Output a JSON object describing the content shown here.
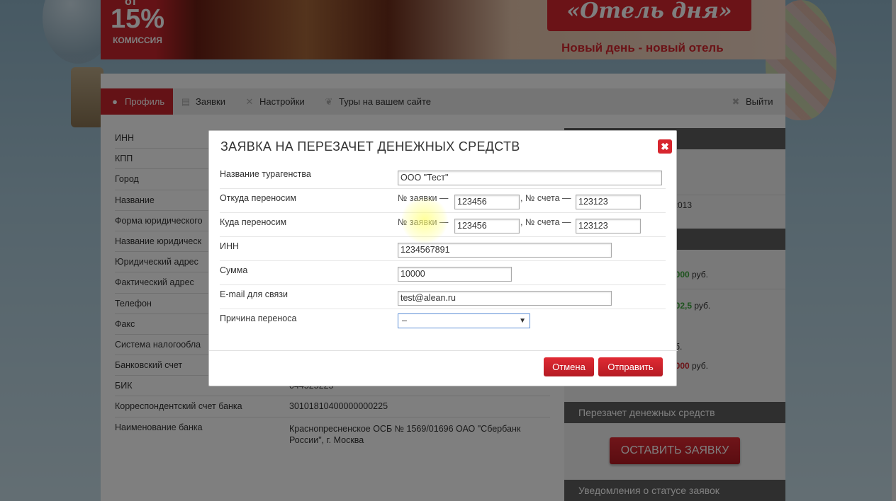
{
  "banner": {
    "promo_top": "от",
    "promo_percent": "15%",
    "promo_sub": "КОМИССИЯ",
    "hotel_day": "«Отель дня»",
    "slogan": "Новый день - новый отель"
  },
  "nav": {
    "items": [
      {
        "label": "Профиль",
        "icon": "user-icon"
      },
      {
        "label": "Заявки",
        "icon": "list-icon"
      },
      {
        "label": "Настройки",
        "icon": "tools-icon"
      },
      {
        "label": "Туры на вашем сайте",
        "icon": "handshake-icon"
      }
    ],
    "logout": "Выйти"
  },
  "profile": {
    "rows": [
      {
        "label": "ИНН",
        "value": ""
      },
      {
        "label": "КПП",
        "value": ""
      },
      {
        "label": "Город",
        "value": ""
      },
      {
        "label": "Название",
        "value": ""
      },
      {
        "label": "Форма юридического",
        "value": ""
      },
      {
        "label": "Название юридическ",
        "value": ""
      },
      {
        "label": "Юридический адрес",
        "value": ""
      },
      {
        "label": "Фактический адрес",
        "value": ""
      },
      {
        "label": "Телефон",
        "value": ""
      },
      {
        "label": "Факс",
        "value": ""
      },
      {
        "label": "Система налогообла",
        "value": ""
      },
      {
        "label": "Банковский счет",
        "value": ""
      },
      {
        "label": "БИК",
        "value": "044525225"
      },
      {
        "label": "Корреспондентский счет банка",
        "value": "30101810400000000225"
      }
    ],
    "bank_label": "Наименование банка",
    "bank_value": "Краснопресненское ОСБ № 1569/01696 ОАО \"Сбербанк России\", г. Москва"
  },
  "side": {
    "date_text": ".2013",
    "sum1": "0000",
    "sum2": "202,5",
    "sum4": "0000",
    "currency": "руб.",
    "currency_short": "уб.",
    "transfer_head": "Перезачет денежных средств",
    "apply_button": "ОСТАВИТЬ ЗАЯВКУ",
    "notify_head": "Уведомления о статусе заявок"
  },
  "modal": {
    "title": "ЗАЯВКА НА ПЕРЕЗАЧЕТ ДЕНЕЖНЫХ СРЕДСТВ",
    "close": "✖",
    "agency_label": "Название турагенства",
    "agency_value": "ООО \"Тест\"",
    "from_label": "Откуда переносим",
    "to_label": "Куда переносим",
    "order_prefix": "№ заявки —",
    "account_prefix": ", № счета —",
    "from_order": "123456",
    "from_account": "123123",
    "to_order": "123456",
    "to_account": "123123",
    "inn_label": "ИНН",
    "inn_value": "1234567891",
    "sum_label": "Сумма",
    "sum_value": "10000",
    "email_label": "E-mail для связи",
    "email_value": "test@alean.ru",
    "reason_label": "Причина переноса",
    "reason_value": "–",
    "cancel": "Отмена",
    "submit": "Отправить"
  }
}
